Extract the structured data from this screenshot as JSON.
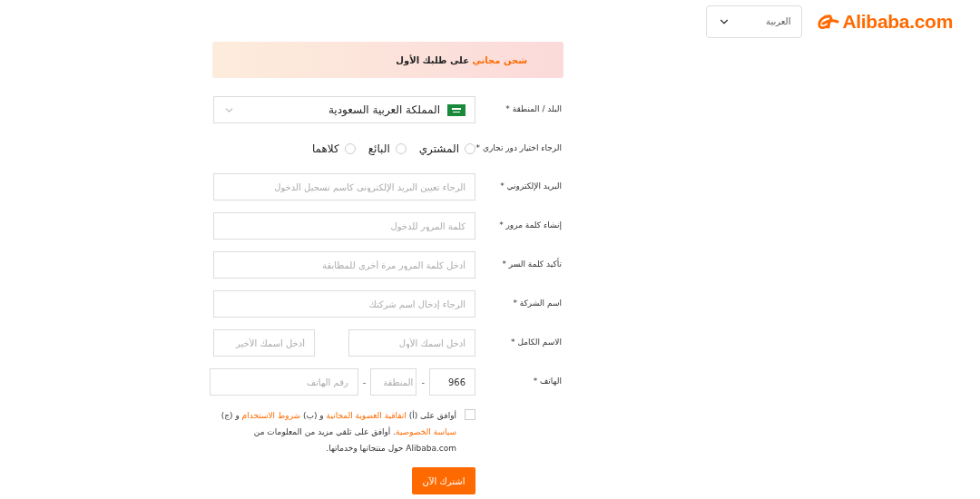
{
  "header": {
    "logo": "Alibaba.com",
    "language": "العربية"
  },
  "banner": [
    {
      "kind": "highlight",
      "text": "شحن مجاني"
    },
    {
      "kind": "plain",
      "text": " على طلبك الأول"
    }
  ],
  "fields": [
    {
      "kind": "country",
      "label": "البلد / المنطقة *",
      "value": "المملكة العربية السعودية"
    },
    {
      "kind": "radio",
      "label": "الرجاء اختيار دور تجاري *",
      "options": [
        {
          "label": "المشتري",
          "selected": false
        },
        {
          "label": "البائع",
          "selected": false
        },
        {
          "label": "كلاهما",
          "selected": false
        }
      ]
    },
    {
      "kind": "text",
      "label": "البريد الإلكتروني *",
      "placeholder": "الرجاء تعيين البريد الإلكتروني كاسم تسجيل الدخول"
    },
    {
      "kind": "text",
      "label": "إنشاء كلمة مرور *",
      "placeholder": "كلمة المرور للدخول"
    },
    {
      "kind": "text",
      "label": "تأكيد كلمة السر *",
      "placeholder": "أدخل كلمة المرور مرة أخرى للمطابقة"
    },
    {
      "kind": "text",
      "label": "اسم الشركة *",
      "placeholder": "الرجاء إدخال اسم شركتك"
    },
    {
      "kind": "name",
      "label": "الاسم الكامل *",
      "first_placeholder": "أدخل اسمك الأول",
      "last_placeholder": "أدخل اسمك الأخير"
    },
    {
      "kind": "phone",
      "label": "الهاتف *",
      "country_code": "966",
      "separators": [
        "-",
        "-"
      ],
      "area_placeholder": "المنطقة",
      "number_placeholder": "رقم الهاتف"
    }
  ],
  "agreement": {
    "checked": false,
    "parts": [
      {
        "kind": "text",
        "text": "أوافق على (أ) "
      },
      {
        "kind": "link",
        "text": "اتفاقية العضوية المجانية"
      },
      {
        "kind": "text",
        "text": " و (ب) "
      },
      {
        "kind": "link",
        "text": "شروط الاستخدام"
      },
      {
        "kind": "text",
        "text": " و (ج) "
      },
      {
        "kind": "link",
        "text": "سياسة الخصوصية"
      },
      {
        "kind": "text",
        "text": ". أوافق على تلقي مزيد من المعلومات من Alibaba.com حول منتجاتها وخدماتها."
      }
    ]
  },
  "submit": "اشترك الآن"
}
